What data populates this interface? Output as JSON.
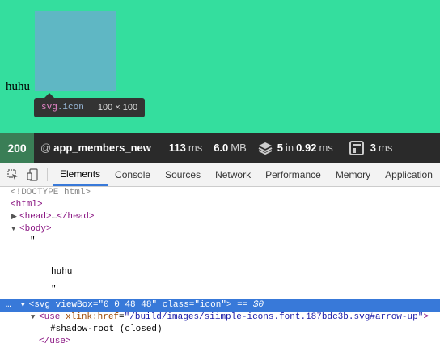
{
  "page": {
    "text": "huhu",
    "tooltip": {
      "tag": "svg",
      "class": ".icon",
      "size": "100 × 100"
    }
  },
  "statusbar": {
    "code": "200",
    "at": "@",
    "route": "app_members_new",
    "time_value": "113",
    "time_unit": "ms",
    "memory_value": "6.0",
    "memory_unit": "MB",
    "queries_value": "5",
    "queries_in": "in",
    "queries_time": "0.92",
    "queries_unit": "ms",
    "render_value": "3",
    "render_unit": "ms"
  },
  "devtools": {
    "tabs": [
      "Elements",
      "Console",
      "Sources",
      "Network",
      "Performance",
      "Memory",
      "Application"
    ],
    "active_tab": "Elements"
  },
  "dom_tree": {
    "doctype": "<!DOCTYPE html>",
    "html_open": "<html>",
    "head_open": "<head>",
    "head_ellipsis": "…",
    "head_close": "</head>",
    "body_open": "<body>",
    "quote1": "\"",
    "text_node": "huhu",
    "quote2": "\"",
    "svg_prefix": "…",
    "svg_open": "<svg",
    "svg_attr1_name": "viewBox",
    "svg_attr1_value": "\"0 0 48 48\"",
    "svg_attr2_name": "class",
    "svg_attr2_value": "\"icon\"",
    "svg_close_bracket": ">",
    "svg_dollar": " == $0",
    "use_open": "<use",
    "use_attr_name": "xlink:href",
    "use_attr_value": "\"/build/images/siimple-icons.font.187bdc3b.svg#arrow-up\"",
    "use_close_bracket": ">",
    "shadow_root": "#shadow-root (closed)",
    "use_close": "</use>"
  }
}
